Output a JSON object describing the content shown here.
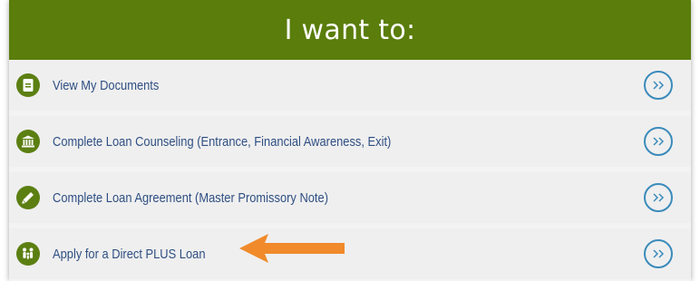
{
  "header": {
    "title": "I want to:"
  },
  "menu": {
    "items": [
      {
        "label": "View My Documents",
        "icon": "document-icon"
      },
      {
        "label": "Complete Loan Counseling (Entrance, Financial Awareness, Exit)",
        "icon": "bank-icon"
      },
      {
        "label": "Complete Loan Agreement (Master Promissory Note)",
        "icon": "pencil-icon"
      },
      {
        "label": "Apply for a Direct PLUS Loan",
        "icon": "family-icon"
      }
    ],
    "chevron_icon": "double-chevron-right-icon"
  },
  "colors": {
    "header_bg": "#5a7d0b",
    "icon_bg": "#5c7f12",
    "label_text": "#2f4f83",
    "chevron": "#3a8bbb",
    "annotation_arrow": "#f08a2a"
  },
  "annotation": {
    "icon": "orange-arrow-icon"
  }
}
